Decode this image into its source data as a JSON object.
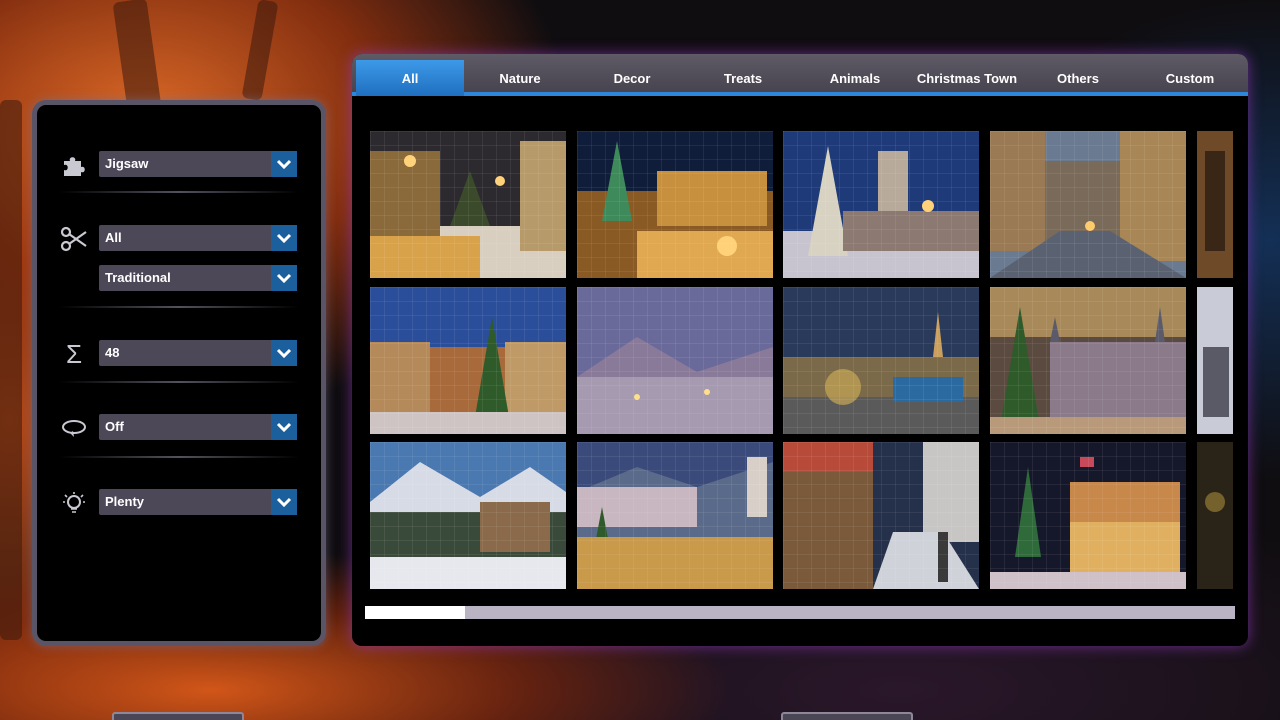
{
  "tabs": [
    {
      "label": "All",
      "active": true
    },
    {
      "label": "Nature",
      "active": false
    },
    {
      "label": "Decor",
      "active": false
    },
    {
      "label": "Treats",
      "active": false
    },
    {
      "label": "Animals",
      "active": false
    },
    {
      "label": "Christmas Town",
      "active": false
    },
    {
      "label": "Others",
      "active": false
    },
    {
      "label": "Custom",
      "active": false
    }
  ],
  "options": {
    "puzzle_type": {
      "icon": "puzzle-piece-icon",
      "value": "Jigsaw"
    },
    "cut_set": {
      "icon": "scissors-icon",
      "value": "All"
    },
    "cut_style": {
      "value": "Traditional"
    },
    "piece_count": {
      "icon": "sigma-icon",
      "value": "48"
    },
    "rotation": {
      "icon": "rotate-icon",
      "value": "Off"
    },
    "hints": {
      "icon": "lightbulb-icon",
      "value": "Plenty"
    }
  },
  "gallery": {
    "thumbnails": [
      {
        "name": "christmas-market-street-image"
      },
      {
        "name": "christmas-market-square-image"
      },
      {
        "name": "town-hall-christmas-tree-image"
      },
      {
        "name": "old-town-street-image"
      },
      {
        "name": "snowy-town-christmas-tree-image"
      },
      {
        "name": "snowy-village-dusk-image"
      },
      {
        "name": "illuminated-harbor-town-image"
      },
      {
        "name": "cathedral-square-tree-image"
      },
      {
        "name": "alpine-village-snow-image"
      },
      {
        "name": "mountain-town-market-image"
      },
      {
        "name": "snowy-lane-lights-image"
      },
      {
        "name": "carousel-christmas-night-image"
      }
    ],
    "scroll_position": 0.11
  },
  "colors": {
    "accent_blue": "#1b5f9c",
    "tab_active": "#2d86d9",
    "dropdown_bg": "#4d4858",
    "panel_glow": "#9640c8"
  }
}
